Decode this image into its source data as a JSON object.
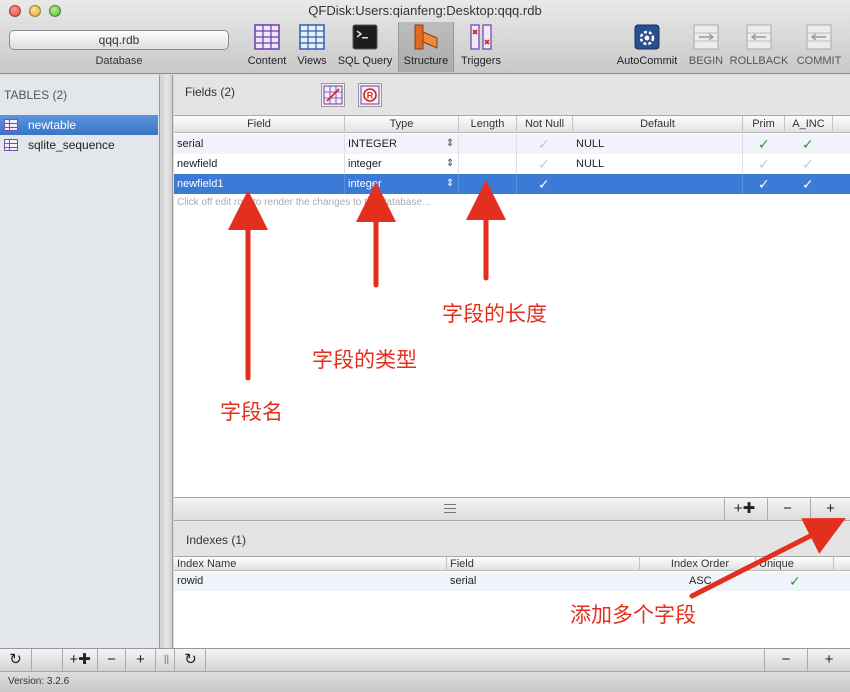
{
  "window": {
    "title": "QFDisk:Users:qianfeng:Desktop:qqq.rdb"
  },
  "toolbar": {
    "database_name": "qqq.rdb",
    "database_label": "Database",
    "buttons": [
      {
        "label": "Content",
        "icon": "grid-table-icon"
      },
      {
        "label": "Views",
        "icon": "views-table-icon"
      },
      {
        "label": "SQL Query",
        "icon": "terminal-icon"
      },
      {
        "label": "Structure",
        "icon": "structure-icon"
      },
      {
        "label": "Triggers",
        "icon": "triggers-icon"
      },
      {
        "label": "AutoCommit",
        "icon": "gear-icon"
      },
      {
        "label": "BEGIN",
        "icon": "transaction-icon"
      },
      {
        "label": "ROLLBACK",
        "icon": "transaction-icon"
      },
      {
        "label": "COMMIT",
        "icon": "transaction-icon"
      }
    ]
  },
  "sidebar": {
    "header": "TABLES (2)",
    "items": [
      {
        "label": "newtable",
        "selected": true
      },
      {
        "label": "sqlite_sequence",
        "selected": false
      }
    ]
  },
  "fields": {
    "header": "Fields (2)",
    "columns": [
      "Field",
      "Type",
      "Length",
      "Not Null",
      "Default",
      "Prim",
      "A_INC"
    ],
    "rows": [
      {
        "field": "serial",
        "type": "INTEGER",
        "length": "",
        "not_null": false,
        "default": "NULL",
        "prim": true,
        "a_inc": true
      },
      {
        "field": "newfield",
        "type": "integer",
        "length": "",
        "not_null": false,
        "default": "NULL",
        "prim": false,
        "a_inc": false
      },
      {
        "field": "newfield1",
        "type": "integer",
        "length": "",
        "not_null": true,
        "default": "",
        "prim": true,
        "a_inc": true
      }
    ],
    "hint": "Click off edit row to render the changes to the database..."
  },
  "indexes": {
    "header": "Indexes (1)",
    "columns": [
      "Index Name",
      "Field",
      "Index Order",
      "Unique"
    ],
    "rows": [
      {
        "name": "rowid",
        "field": "serial",
        "order": "ASC",
        "unique": true
      }
    ]
  },
  "buttons": {
    "add_multi": "+✚",
    "remove": "−",
    "add": "+",
    "refresh": "↻"
  },
  "status": {
    "version": "Version: 3.2.6"
  },
  "annotations": {
    "field_name": "字段名",
    "field_type": "字段的类型",
    "field_length": "字段的长度",
    "add_multi": "添加多个字段"
  },
  "colors": {
    "accent": "#3b7ad6",
    "check": "#2a9a2a",
    "annotation": "#e32f1e"
  }
}
